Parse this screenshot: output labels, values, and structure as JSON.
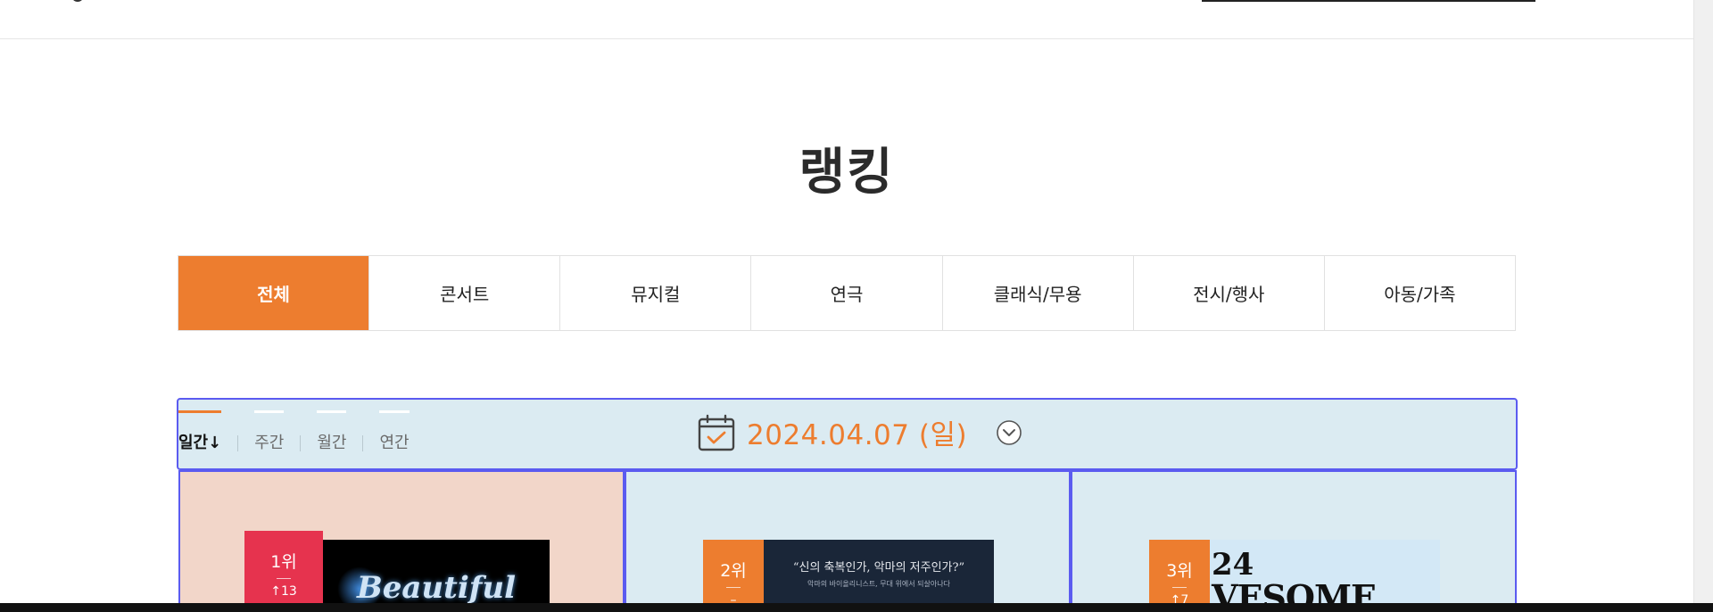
{
  "header": {},
  "page_title": "랭킹",
  "categories": [
    {
      "label": "전체",
      "active": true
    },
    {
      "label": "콘서트",
      "active": false
    },
    {
      "label": "뮤지컬",
      "active": false
    },
    {
      "label": "연극",
      "active": false
    },
    {
      "label": "클래식/무용",
      "active": false
    },
    {
      "label": "전시/행사",
      "active": false
    },
    {
      "label": "아동/가족",
      "active": false
    }
  ],
  "period": {
    "tabs": [
      {
        "label": "일간↓",
        "active": true
      },
      {
        "label": "주간",
        "active": false
      },
      {
        "label": "월간",
        "active": false
      },
      {
        "label": "연간",
        "active": false
      }
    ],
    "date": "2024.04.07 (일)",
    "icons": {
      "calendar": "calendar-check-icon",
      "toggle": "chevron-down-circle-icon"
    }
  },
  "ranking": [
    {
      "rank": "1위",
      "change": "↑13",
      "poster_text": "Beautiful",
      "badge_color": "#e6334e"
    },
    {
      "rank": "2위",
      "change": "–",
      "poster_text": "“신의 축복인가, 악마의 저주인가?”",
      "poster_sub": "악마의 바이올리니스트, 무대 위에서 되살아나다",
      "badge_color": "#ed7d2f"
    },
    {
      "rank": "3위",
      "change": "↑7",
      "poster_line1": "24",
      "poster_line2": "VESOME",
      "badge_color": "#ed7d2f"
    }
  ],
  "colors": {
    "accent": "#ed7d2f",
    "rank1": "#e6334e",
    "highlight_border": "#5b5bf0",
    "panel_bg": "#dbebf2"
  }
}
